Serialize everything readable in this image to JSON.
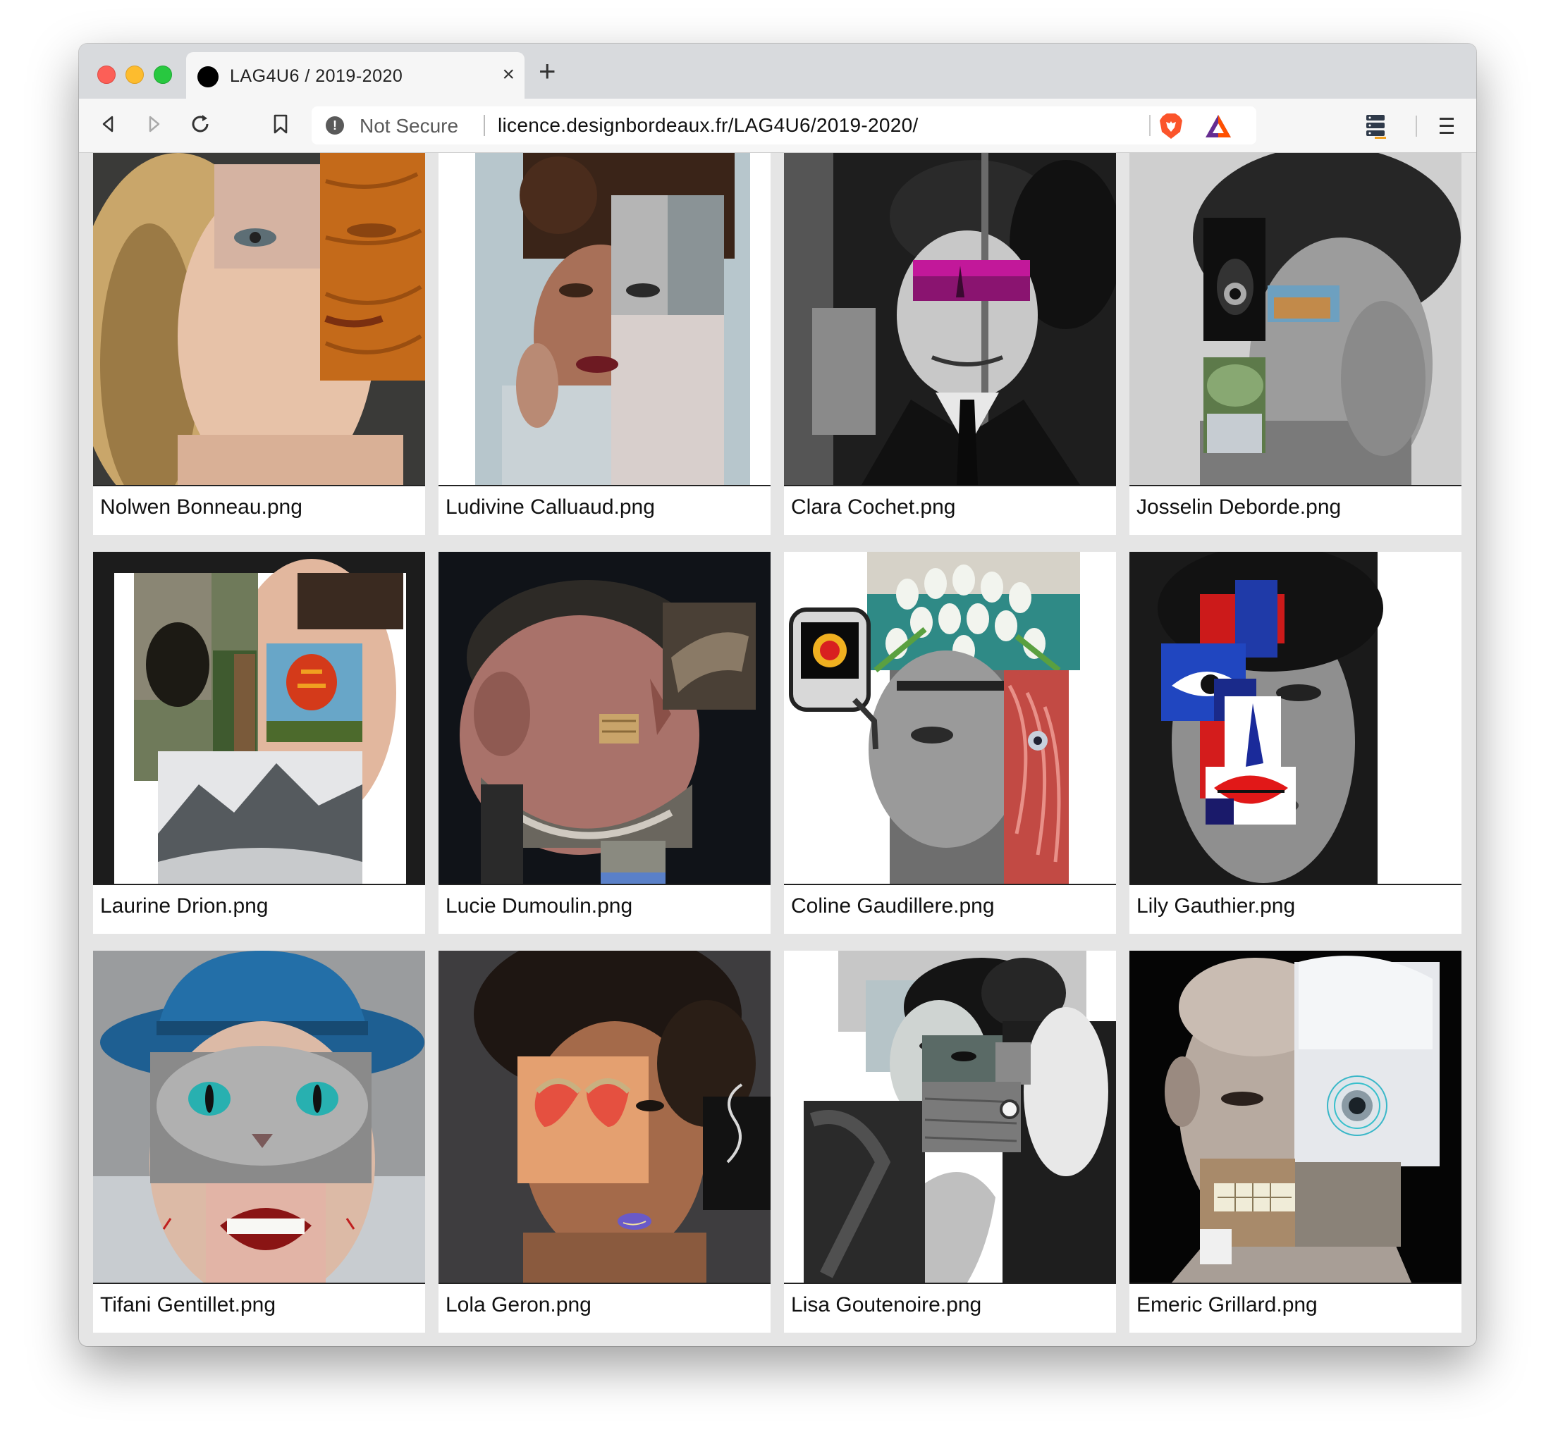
{
  "browser": {
    "tab_title": "LAG4U6 / 2019-2020",
    "tab_close_icon": "×",
    "new_tab_icon": "+",
    "security_label": "Not Secure",
    "url": "licence.designbordeaux.fr/LAG4U6/2019-2020/"
  },
  "colors": {
    "traffic_red": "#fc5f57",
    "traffic_yellow": "#fdbc2e",
    "traffic_green": "#28c840",
    "brave_orange": "#fb542b"
  },
  "gallery": [
    {
      "filename": "Nolwen Bonneau.png"
    },
    {
      "filename": "Ludivine Calluaud.png"
    },
    {
      "filename": "Clara Cochet.png"
    },
    {
      "filename": "Josselin Deborde.png"
    },
    {
      "filename": "Laurine Drion.png"
    },
    {
      "filename": "Lucie Dumoulin.png"
    },
    {
      "filename": "Coline Gaudillere.png"
    },
    {
      "filename": "Lily Gauthier.png"
    },
    {
      "filename": "Tifani Gentillet.png"
    },
    {
      "filename": "Lola Geron.png"
    },
    {
      "filename": "Lisa Goutenoire.png"
    },
    {
      "filename": "Emeric Grillard.png"
    }
  ]
}
